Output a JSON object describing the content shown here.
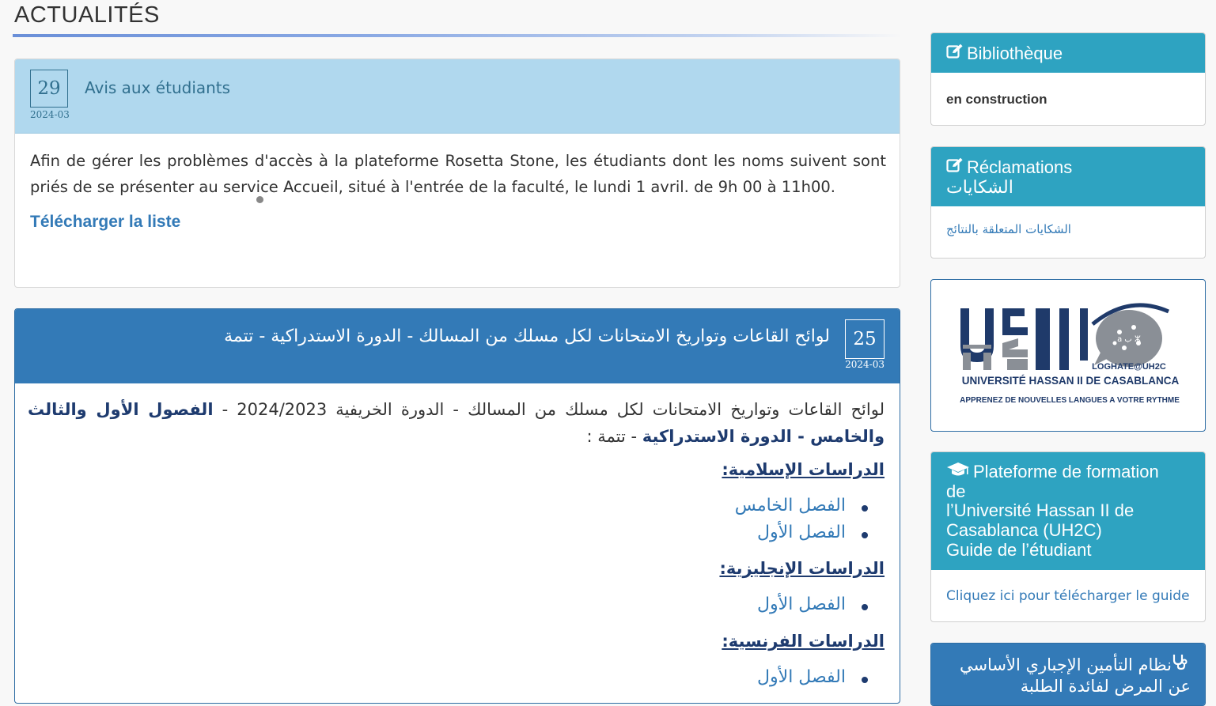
{
  "page": {
    "title": "ACTUALITÉS"
  },
  "news": [
    {
      "day": "29",
      "year_month": "2024-03",
      "title": "Avis aux étudiants",
      "body": "Afin de gérer les problèmes d'accès à la plateforme Rosetta Stone, les étudiants dont les noms suivent sont priés de se présenter au service Accueil, situé à l'entrée de la faculté, le lundi 1 avril. de 9h 00 à 11h00.",
      "link": "Télécharger la liste"
    },
    {
      "day": "25",
      "year_month": "2024-03",
      "title": "لوائح القاعات وتواريخ الامتحانات لكل مسلك من المسالك - الدورة الاستدراكية - تتمة",
      "intro_regular": "لوائح القاعات وتواريخ الامتحانات لكل مسلك من المسالك - الدورة الخريفية 2024/2023 - ",
      "intro_bold": "الفصول الأول والثالث والخامس - الدورة الاستدراكية",
      "intro_end": " - تتمة :",
      "sections": [
        {
          "heading": "الدراسات الإسلامية:",
          "items": [
            "الفصل الخامس",
            "الفصل الأول"
          ]
        },
        {
          "heading": "الدراسات الإنجليزية:",
          "items": [
            "الفصل الأول"
          ]
        },
        {
          "heading": "الدراسات الفرنسية:",
          "items": [
            "الفصل الأول"
          ]
        }
      ]
    }
  ],
  "sidebar": {
    "bibliotheque": {
      "icon": "edit-icon",
      "title": "Bibliothèque",
      "text": "en construction"
    },
    "reclamations": {
      "icon": "edit-icon",
      "title": "Réclamations",
      "title_ar": "الشكايات",
      "link": "الشكايات المتعلقة بالنتائج"
    },
    "logo": {
      "brand": "LOGHATE@UH2C",
      "university": "UNIVERSITÉ HASSAN II DE CASABLANCA",
      "tagline": "APPRENEZ DE NOUVELLES LANGUES A VOTRE RYTHME",
      "bubble_chars": "a ب ⵣ"
    },
    "plateforme": {
      "icon": "graduation-cap-icon",
      "lines": [
        "Plateforme de formation",
        "de",
        "l’Université Hassan II de",
        "Casablanca (UH2C)",
        "Guide de l’étudiant"
      ],
      "link": "Cliquez ici pour télécharger le guide"
    },
    "assurance": {
      "icon": "stethoscope-icon",
      "title": "نظام التأمين الإجباري الأساسي عن المرض لفائدة الطلبة"
    }
  },
  "colors": {
    "info_panel_head": "#b0d8ee",
    "primary_panel_head": "#337ab7",
    "sidebar_head": "#2ea3c1",
    "link": "#337ab7",
    "arabic_heading": "#1e3b6f"
  }
}
